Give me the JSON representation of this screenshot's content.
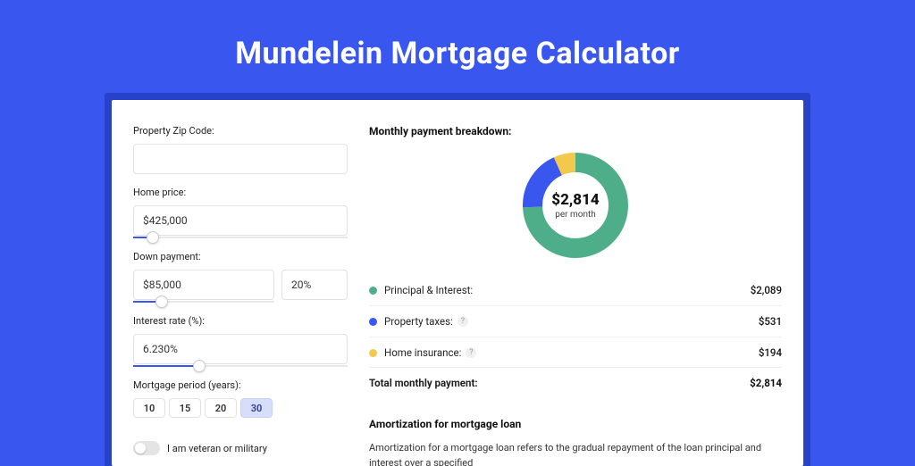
{
  "title": "Mundelein Mortgage Calculator",
  "left": {
    "zip_label": "Property Zip Code:",
    "zip_value": "",
    "price_label": "Home price:",
    "price_value": "$425,000",
    "price_slider_pct": 9,
    "down_label": "Down payment:",
    "down_amount": "$85,000",
    "down_pct": "20%",
    "down_slider_pct": 20,
    "rate_label": "Interest rate (%):",
    "rate_value": "6.230%",
    "rate_slider_pct": 31,
    "period_label": "Mortgage period (years):",
    "periods": [
      "10",
      "15",
      "20",
      "30"
    ],
    "period_selected": "30",
    "vet_label": "I am veteran or military"
  },
  "breakdown": {
    "heading": "Monthly payment breakdown:",
    "center_value": "$2,814",
    "center_per": "per month",
    "items": [
      {
        "label": "Principal & Interest:",
        "amount": "$2,089",
        "color": "g",
        "help": false,
        "value": 2089
      },
      {
        "label": "Property taxes:",
        "amount": "$531",
        "color": "b",
        "help": true,
        "value": 531
      },
      {
        "label": "Home insurance:",
        "amount": "$194",
        "color": "y",
        "help": true,
        "value": 194
      }
    ],
    "total_label": "Total monthly payment:",
    "total_amount": "$2,814"
  },
  "amort": {
    "heading": "Amortization for mortgage loan",
    "body": "Amortization for a mortgage loan refers to the gradual repayment of the loan principal and interest over a specified"
  },
  "colors": {
    "g": "#4fae8a",
    "b": "#3957ee",
    "y": "#f2c94c"
  },
  "chart_data": {
    "type": "pie",
    "title": "Monthly payment breakdown",
    "series": [
      {
        "name": "Principal & Interest",
        "value": 2089,
        "color": "#4fae8a"
      },
      {
        "name": "Property taxes",
        "value": 531,
        "color": "#3957ee"
      },
      {
        "name": "Home insurance",
        "value": 194,
        "color": "#f2c94c"
      }
    ],
    "total": 2814,
    "center_label": "$2,814 per month"
  }
}
